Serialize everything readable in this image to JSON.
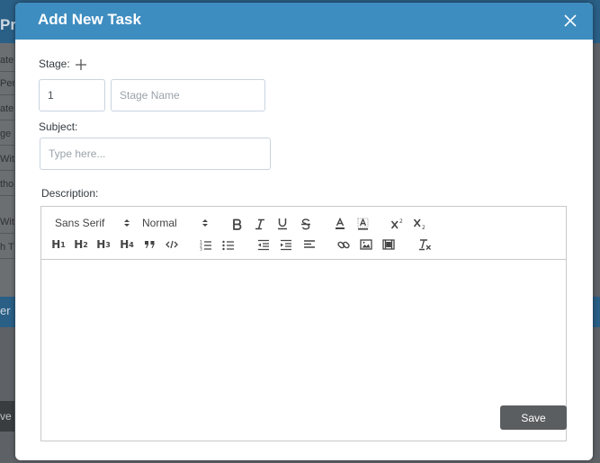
{
  "background": {
    "topbar_text": "Pr",
    "side_items": [
      "ate",
      "Pers",
      "ate",
      "ge",
      "Wit",
      "tho",
      "Wit",
      "h T"
    ],
    "band_text": "er",
    "button_text": "ve P"
  },
  "modal": {
    "title": "Add New Task",
    "stage_label": "Stage:",
    "stage_number_value": "1",
    "stage_name_placeholder": "Stage Name",
    "subject_label": "Subject:",
    "subject_placeholder": "Type here...",
    "description_label": "Description:",
    "save_label": "Save"
  },
  "editor": {
    "font_picker_label": "Sans Serif",
    "size_picker_label": "Normal",
    "headings": [
      {
        "letter": "H",
        "num": "1"
      },
      {
        "letter": "H",
        "num": "2"
      },
      {
        "letter": "H",
        "num": "3"
      },
      {
        "letter": "H",
        "num": "4"
      }
    ],
    "content": ""
  },
  "colors": {
    "header": "#3e8dc0",
    "save_button": "#5b5e61",
    "border": "#c8d4df"
  }
}
